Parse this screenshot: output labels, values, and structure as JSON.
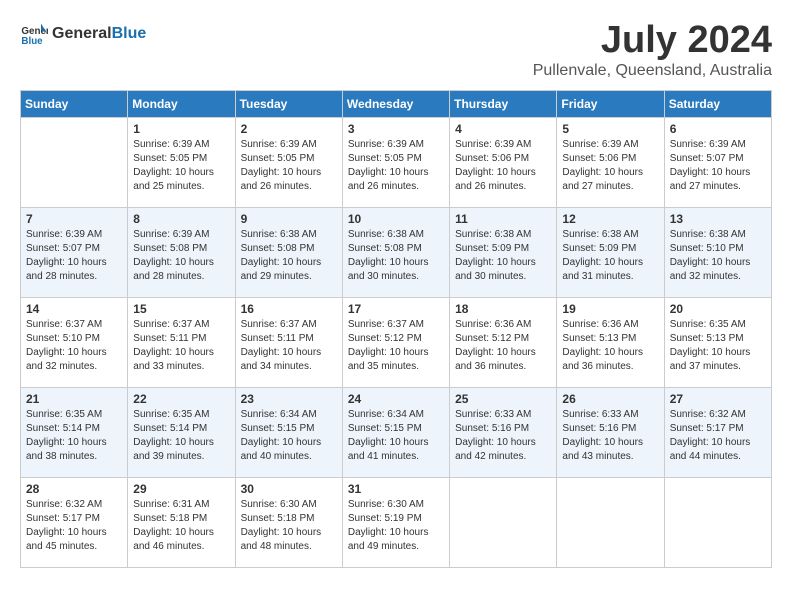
{
  "header": {
    "logo_general": "General",
    "logo_blue": "Blue",
    "month_year": "July 2024",
    "location": "Pullenvale, Queensland, Australia"
  },
  "days_of_week": [
    "Sunday",
    "Monday",
    "Tuesday",
    "Wednesday",
    "Thursday",
    "Friday",
    "Saturday"
  ],
  "weeks": [
    [
      {
        "day": "",
        "info": ""
      },
      {
        "day": "1",
        "info": "Sunrise: 6:39 AM\nSunset: 5:05 PM\nDaylight: 10 hours\nand 25 minutes."
      },
      {
        "day": "2",
        "info": "Sunrise: 6:39 AM\nSunset: 5:05 PM\nDaylight: 10 hours\nand 26 minutes."
      },
      {
        "day": "3",
        "info": "Sunrise: 6:39 AM\nSunset: 5:05 PM\nDaylight: 10 hours\nand 26 minutes."
      },
      {
        "day": "4",
        "info": "Sunrise: 6:39 AM\nSunset: 5:06 PM\nDaylight: 10 hours\nand 26 minutes."
      },
      {
        "day": "5",
        "info": "Sunrise: 6:39 AM\nSunset: 5:06 PM\nDaylight: 10 hours\nand 27 minutes."
      },
      {
        "day": "6",
        "info": "Sunrise: 6:39 AM\nSunset: 5:07 PM\nDaylight: 10 hours\nand 27 minutes."
      }
    ],
    [
      {
        "day": "7",
        "info": "Sunrise: 6:39 AM\nSunset: 5:07 PM\nDaylight: 10 hours\nand 28 minutes."
      },
      {
        "day": "8",
        "info": "Sunrise: 6:39 AM\nSunset: 5:08 PM\nDaylight: 10 hours\nand 28 minutes."
      },
      {
        "day": "9",
        "info": "Sunrise: 6:38 AM\nSunset: 5:08 PM\nDaylight: 10 hours\nand 29 minutes."
      },
      {
        "day": "10",
        "info": "Sunrise: 6:38 AM\nSunset: 5:08 PM\nDaylight: 10 hours\nand 30 minutes."
      },
      {
        "day": "11",
        "info": "Sunrise: 6:38 AM\nSunset: 5:09 PM\nDaylight: 10 hours\nand 30 minutes."
      },
      {
        "day": "12",
        "info": "Sunrise: 6:38 AM\nSunset: 5:09 PM\nDaylight: 10 hours\nand 31 minutes."
      },
      {
        "day": "13",
        "info": "Sunrise: 6:38 AM\nSunset: 5:10 PM\nDaylight: 10 hours\nand 32 minutes."
      }
    ],
    [
      {
        "day": "14",
        "info": "Sunrise: 6:37 AM\nSunset: 5:10 PM\nDaylight: 10 hours\nand 32 minutes."
      },
      {
        "day": "15",
        "info": "Sunrise: 6:37 AM\nSunset: 5:11 PM\nDaylight: 10 hours\nand 33 minutes."
      },
      {
        "day": "16",
        "info": "Sunrise: 6:37 AM\nSunset: 5:11 PM\nDaylight: 10 hours\nand 34 minutes."
      },
      {
        "day": "17",
        "info": "Sunrise: 6:37 AM\nSunset: 5:12 PM\nDaylight: 10 hours\nand 35 minutes."
      },
      {
        "day": "18",
        "info": "Sunrise: 6:36 AM\nSunset: 5:12 PM\nDaylight: 10 hours\nand 36 minutes."
      },
      {
        "day": "19",
        "info": "Sunrise: 6:36 AM\nSunset: 5:13 PM\nDaylight: 10 hours\nand 36 minutes."
      },
      {
        "day": "20",
        "info": "Sunrise: 6:35 AM\nSunset: 5:13 PM\nDaylight: 10 hours\nand 37 minutes."
      }
    ],
    [
      {
        "day": "21",
        "info": "Sunrise: 6:35 AM\nSunset: 5:14 PM\nDaylight: 10 hours\nand 38 minutes."
      },
      {
        "day": "22",
        "info": "Sunrise: 6:35 AM\nSunset: 5:14 PM\nDaylight: 10 hours\nand 39 minutes."
      },
      {
        "day": "23",
        "info": "Sunrise: 6:34 AM\nSunset: 5:15 PM\nDaylight: 10 hours\nand 40 minutes."
      },
      {
        "day": "24",
        "info": "Sunrise: 6:34 AM\nSunset: 5:15 PM\nDaylight: 10 hours\nand 41 minutes."
      },
      {
        "day": "25",
        "info": "Sunrise: 6:33 AM\nSunset: 5:16 PM\nDaylight: 10 hours\nand 42 minutes."
      },
      {
        "day": "26",
        "info": "Sunrise: 6:33 AM\nSunset: 5:16 PM\nDaylight: 10 hours\nand 43 minutes."
      },
      {
        "day": "27",
        "info": "Sunrise: 6:32 AM\nSunset: 5:17 PM\nDaylight: 10 hours\nand 44 minutes."
      }
    ],
    [
      {
        "day": "28",
        "info": "Sunrise: 6:32 AM\nSunset: 5:17 PM\nDaylight: 10 hours\nand 45 minutes."
      },
      {
        "day": "29",
        "info": "Sunrise: 6:31 AM\nSunset: 5:18 PM\nDaylight: 10 hours\nand 46 minutes."
      },
      {
        "day": "30",
        "info": "Sunrise: 6:30 AM\nSunset: 5:18 PM\nDaylight: 10 hours\nand 48 minutes."
      },
      {
        "day": "31",
        "info": "Sunrise: 6:30 AM\nSunset: 5:19 PM\nDaylight: 10 hours\nand 49 minutes."
      },
      {
        "day": "",
        "info": ""
      },
      {
        "day": "",
        "info": ""
      },
      {
        "day": "",
        "info": ""
      }
    ]
  ]
}
